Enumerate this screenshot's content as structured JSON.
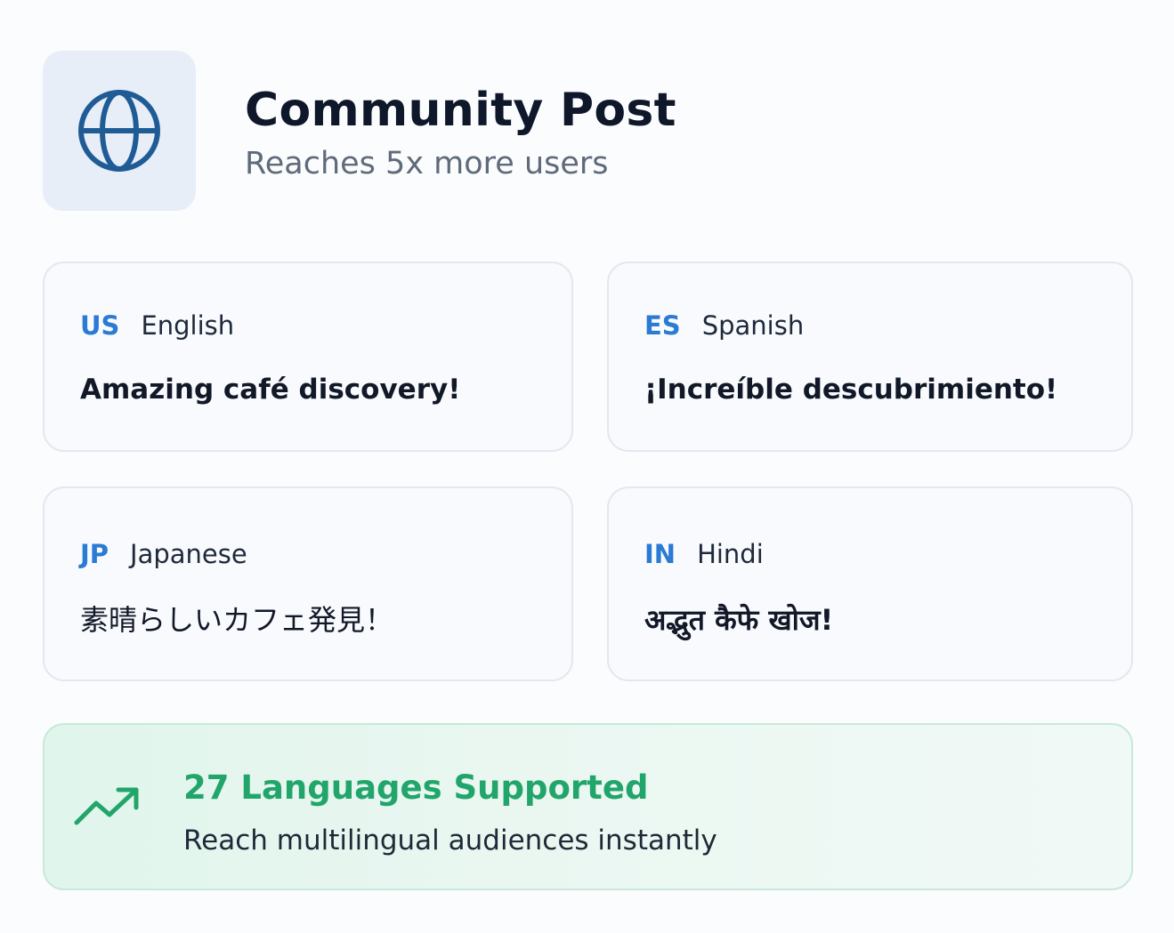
{
  "header": {
    "icon": "globe-icon",
    "title": "Community Post",
    "subtitle": "Reaches 5x more users"
  },
  "translations": [
    {
      "code": "US",
      "language": "English",
      "text": "Amazing café discovery!"
    },
    {
      "code": "ES",
      "language": "Spanish",
      "text": "¡Increíble descubrimiento!"
    },
    {
      "code": "JP",
      "language": "Japanese",
      "text": "素晴らしいカフェ発見！"
    },
    {
      "code": "IN",
      "language": "Hindi",
      "text": "अद्भुत कैफे खोज!"
    }
  ],
  "banner": {
    "icon": "trending-up-icon",
    "title": "27 Languages Supported",
    "subtitle": "Reach multilingual audiences instantly"
  },
  "colors": {
    "accent_blue": "#2b7ad4",
    "globe_blue": "#1f5c96",
    "success_green": "#21a56b"
  }
}
